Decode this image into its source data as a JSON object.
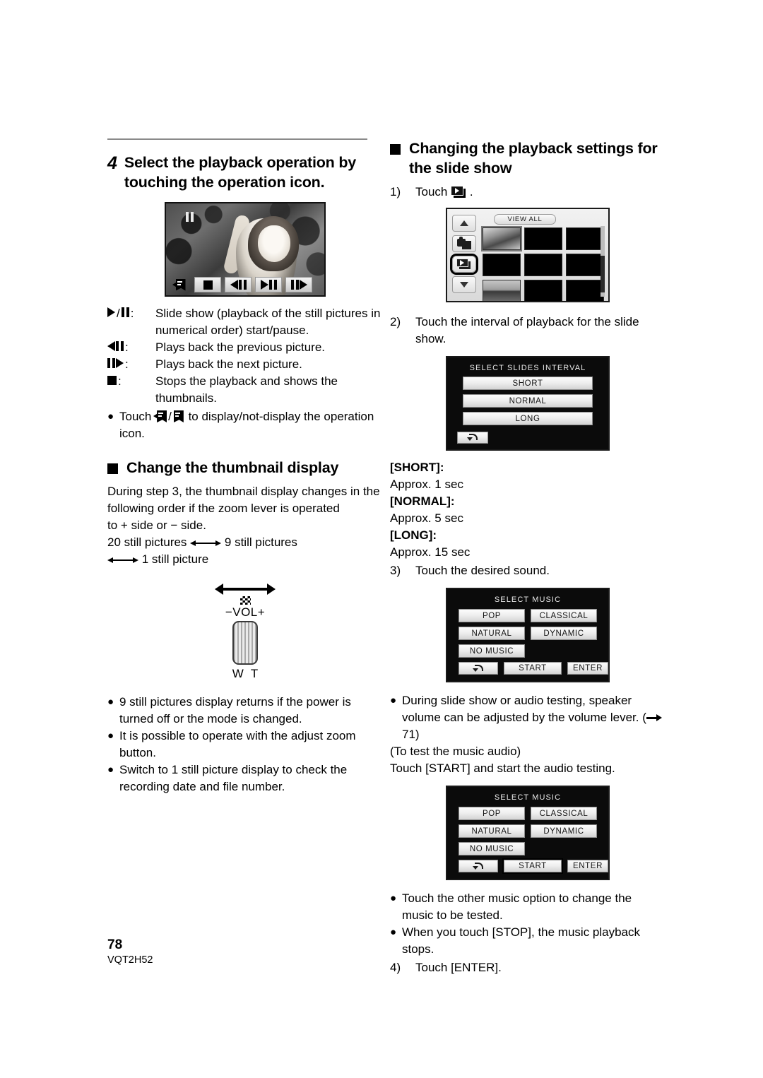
{
  "left_column": {
    "step": {
      "number": "4",
      "title": "Select the playback operation by touching the operation icon."
    },
    "playback_screen": {
      "pause_indicator": "pause",
      "buttons": [
        "hide-icon",
        "stop",
        "previous",
        "play-pause",
        "next"
      ]
    },
    "icon_definitions": [
      {
        "icon": "play-pause",
        "text": "Slide show (playback of the still pictures in numerical order) start/pause."
      },
      {
        "icon": "previous",
        "text": "Plays back the previous picture."
      },
      {
        "icon": "next",
        "text": "Plays back the next picture."
      },
      {
        "icon": "stop",
        "text": "Stops the playback and shows the thumbnails."
      }
    ],
    "touch_note": {
      "prefix": "Touch",
      "separator": "/",
      "suffix": "to display/not-display the operation icon."
    },
    "thumbnail_section": {
      "heading": "Change the thumbnail display",
      "paragraph_1": "During step 3, the thumbnail display changes in the following order if the zoom lever is operated",
      "paragraph_2_pre": "to",
      "plus": "+",
      "paragraph_2_mid": "side or",
      "minus": "−",
      "paragraph_2_post": "side.",
      "order_line_1_a": "20 still pictures",
      "order_line_1_b": "9 still pictures",
      "order_line_2": "1 still picture"
    },
    "lever": {
      "vol_label": "−VOL+",
      "w_label": "W",
      "t_label": "T"
    },
    "notes": [
      "9 still pictures display returns if the power is turned off or the mode is changed.",
      "It is possible to operate with the adjust zoom button.",
      "Switch to 1 still picture display to check the recording date and file number."
    ]
  },
  "right_column": {
    "heading": "Changing the playback settings for the slide show",
    "step1": {
      "number": "1)",
      "text_before": "Touch",
      "text_after": "."
    },
    "thumbnail_screen": {
      "view_all": "VIEW ALL",
      "side_buttons": [
        "scroll-up",
        "photo-mode",
        "slideshow-mode",
        "scroll-down"
      ],
      "selected_side_button": "slideshow-mode"
    },
    "step2": {
      "number": "2)",
      "text": "Touch the interval of playback for the slide show."
    },
    "interval_screen": {
      "title": "SELECT SLIDES INTERVAL",
      "options": [
        "SHORT",
        "NORMAL",
        "LONG"
      ],
      "back_button": "back-arrow"
    },
    "interval_defs": [
      {
        "label": "[SHORT]:",
        "value": "Approx. 1 sec"
      },
      {
        "label": "[NORMAL]:",
        "value": "Approx. 5 sec"
      },
      {
        "label": "[LONG]:",
        "value": "Approx. 15 sec"
      }
    ],
    "step3": {
      "number": "3)",
      "text": "Touch the desired sound."
    },
    "music_screen": {
      "title": "SELECT MUSIC",
      "options": [
        "POP",
        "CLASSICAL",
        "NATURAL",
        "DYNAMIC",
        "NO MUSIC"
      ],
      "back_button": "back-arrow",
      "start_button": "START",
      "enter_button": "ENTER",
      "selected": ""
    },
    "volume_note": {
      "text": "During slide show or audio testing, speaker volume can be adjusted by the volume lever.",
      "page_ref": "71"
    },
    "audio_test_title": "(To test the music audio)",
    "audio_test_text": "Touch [START] and start the audio testing.",
    "music_screen_2": {
      "title": "SELECT MUSIC",
      "options": [
        "POP",
        "CLASSICAL",
        "NATURAL",
        "DYNAMIC",
        "NO MUSIC"
      ],
      "back_button": "back-arrow",
      "start_button": "START",
      "enter_button": "ENTER",
      "selected": "START"
    },
    "notes": [
      "Touch the other music option to change the music to be tested.",
      "When you touch [STOP], the music playback stops."
    ],
    "step4": {
      "number": "4)",
      "text": "Touch [ENTER]."
    }
  },
  "footer": {
    "page_number": "78",
    "doc_code": "VQT2H52"
  }
}
